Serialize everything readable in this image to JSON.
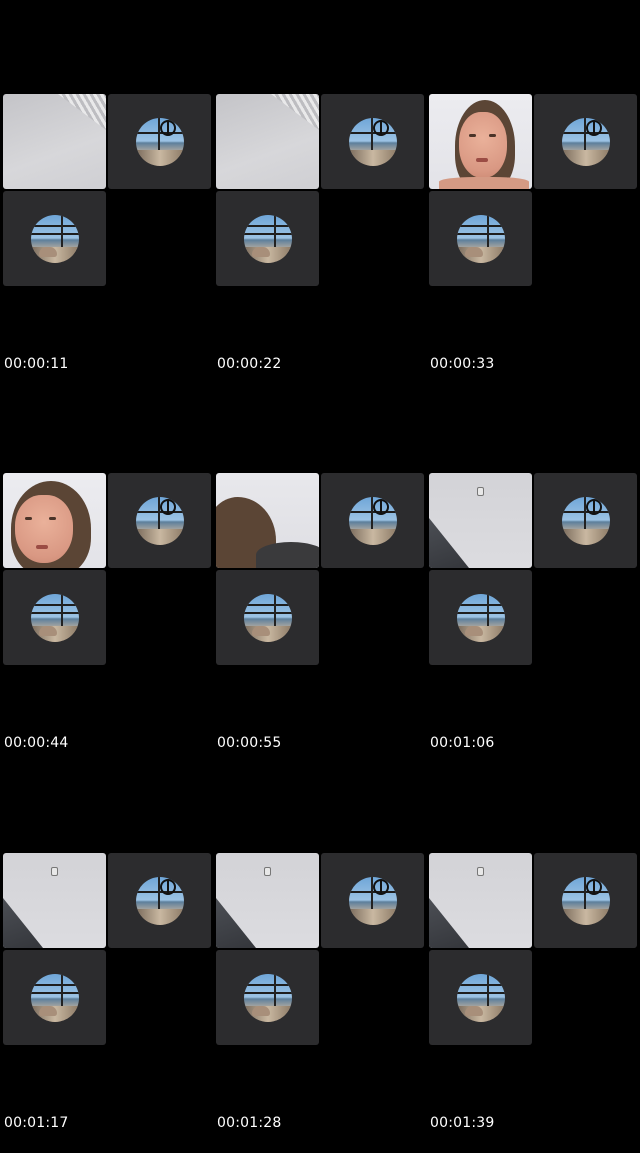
{
  "thumbnails": [
    {
      "timestamp": "00:00:11",
      "main_video": "ceiling"
    },
    {
      "timestamp": "00:00:22",
      "main_video": "ceiling"
    },
    {
      "timestamp": "00:00:33",
      "main_video": "face"
    },
    {
      "timestamp": "00:00:44",
      "main_video": "face"
    },
    {
      "timestamp": "00:00:55",
      "main_video": "face-turned"
    },
    {
      "timestamp": "00:01:06",
      "main_video": "wall"
    },
    {
      "timestamp": "00:01:17",
      "main_video": "wall"
    },
    {
      "timestamp": "00:01:28",
      "main_video": "wall"
    },
    {
      "timestamp": "00:01:39",
      "main_video": "wall"
    }
  ],
  "colors": {
    "background": "#000000",
    "tile_background": "#2c2c2e",
    "timestamp_text": "#ffffff"
  }
}
